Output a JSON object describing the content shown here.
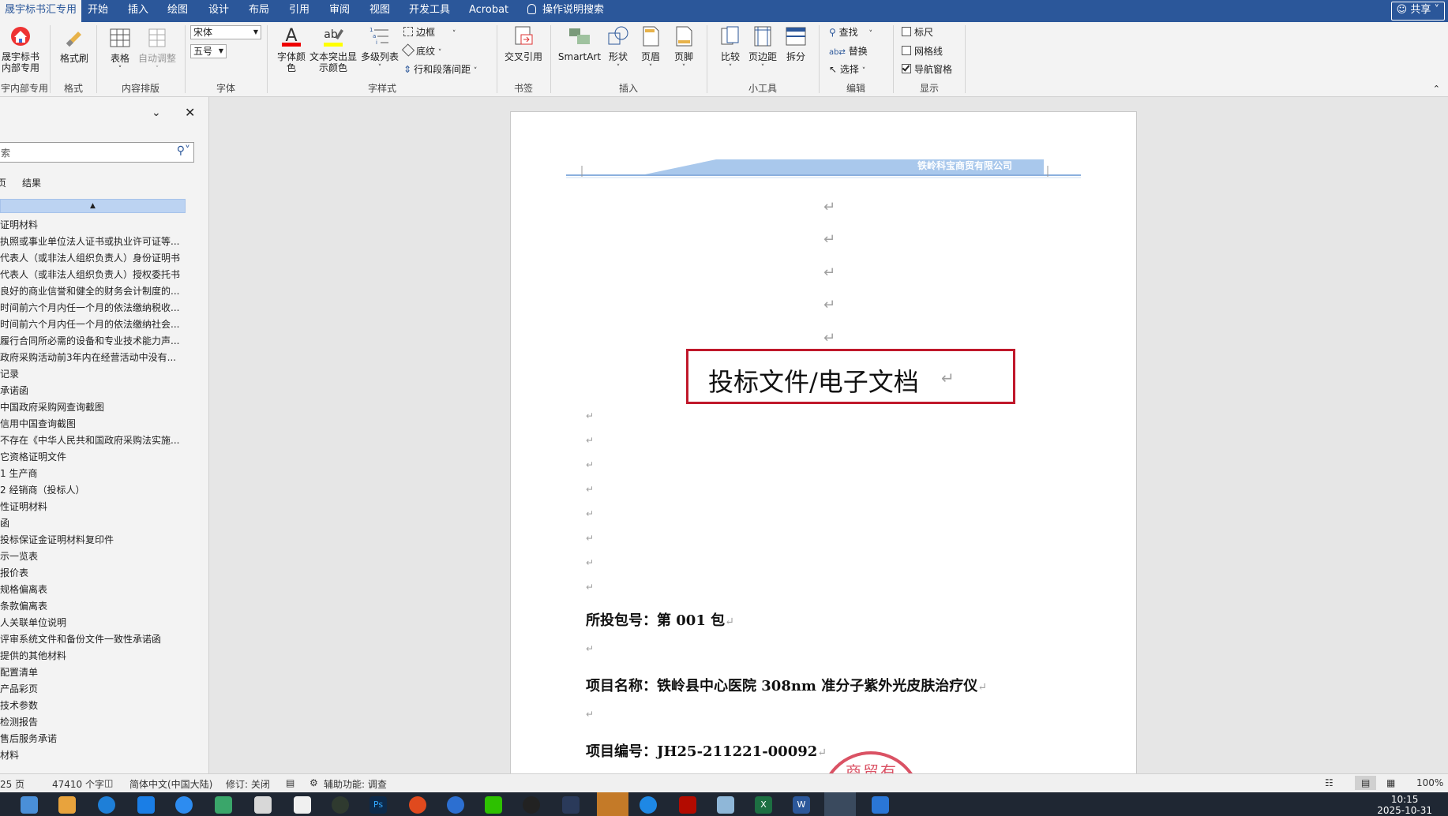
{
  "menubar": {
    "tabs": [
      "晟宇标书汇专用",
      "开始",
      "插入",
      "绘图",
      "设计",
      "布局",
      "引用",
      "审阅",
      "视图",
      "开发工具",
      "Acrobat"
    ],
    "search_label": "操作说明搜索",
    "share_label": "共享"
  },
  "ribbon": {
    "custom_btn_label": "晟宇标书\n内部专用",
    "custom_group": "宇内部专用",
    "format_painter": "格式刷",
    "format_group": "格式",
    "table_btn": "表格",
    "autofit_btn": "自动调整",
    "content_group": "内容排版",
    "font_name": "宋体",
    "font_size": "五号",
    "font_group": "字体",
    "font_color_btn": "字体颜\n色",
    "highlight_btn": "文本突出显\n示颜色",
    "multilevel_btn": "多级列表",
    "border_btn": "边框",
    "shading_btn": "底纹",
    "line_spacing_btn": "行和段落间距",
    "style_group": "字样式",
    "cross_ref_btn": "交叉引用",
    "bookmark_group": "书签",
    "smartart_btn": "SmartArt",
    "shape_btn": "形状",
    "header_btn": "页眉",
    "footer_btn": "页脚",
    "insert_group": "插入",
    "compare_btn": "比较",
    "margin_btn": "页边距",
    "split_btn": "拆分",
    "tools_group": "小工具",
    "find_btn": "查找",
    "replace_btn": "替换",
    "select_btn": "选择",
    "edit_group": "编辑",
    "ruler_label": "标尺",
    "gridline_label": "网格线",
    "navpane_label": "导航窗格",
    "ruler_checked": false,
    "gridline_checked": false,
    "navpane_checked": true,
    "display_group": "显示"
  },
  "navpane": {
    "search_placeholder": "索",
    "tab_pages": "页",
    "tab_results": "结果",
    "items": [
      "证明材料",
      "执照或事业单位法人证书或执业许可证等...",
      "代表人（或非法人组织负责人）身份证明书",
      "代表人（或非法人组织负责人）授权委托书",
      "良好的商业信誉和健全的财务会计制度的...",
      "时间前六个月内任一个月的依法缴纳税收...",
      "时间前六个月内任一个月的依法缴纳社会...",
      "履行合同所必需的设备和专业技术能力声...",
      "政府采购活动前3年内在经营活动中没有...",
      "记录",
      "承诺函",
      "中国政府采购网查询截图",
      "信用中国查询截图",
      "不存在《中华人民共和国政府采购法实施...",
      "它资格证明文件",
      "1 生产商",
      "2 经销商（投标人）",
      "性证明材料",
      "函",
      "投标保证金证明材料复印件",
      "示一览表",
      "报价表",
      "规格偏离表",
      "条款偏离表",
      "人关联单位说明",
      "评审系统文件和备份文件一致性承诺函",
      "提供的其他材料",
      "配置清单",
      "产品彩页",
      "技术参数",
      "检测报告",
      "售后服务承诺",
      "材料"
    ]
  },
  "document": {
    "header_company": "铁岭科宝商贸有限公司",
    "title": "投标文件/电子文档",
    "package_line": "所投包号：第 001 包",
    "project_name_line": "项目名称：铁岭县中心医院 308nm 准分子紫外光皮肤治疗仪",
    "project_code_line": "项目编号：JH25-211221-00092",
    "seal_text": "商贸有"
  },
  "statusbar": {
    "page": "25 页",
    "words": "47410 个字",
    "language": "简体中文(中国大陆)",
    "track_changes": "修订: 关闭",
    "accessibility": "辅助功能: 调查",
    "zoom": "100%"
  },
  "taskbar": {
    "time": "10:15",
    "date": "2025-10-31"
  },
  "colors": {
    "brand": "#2b579a",
    "title_box": "#c0182b",
    "header_band": "#a9c8ec"
  }
}
